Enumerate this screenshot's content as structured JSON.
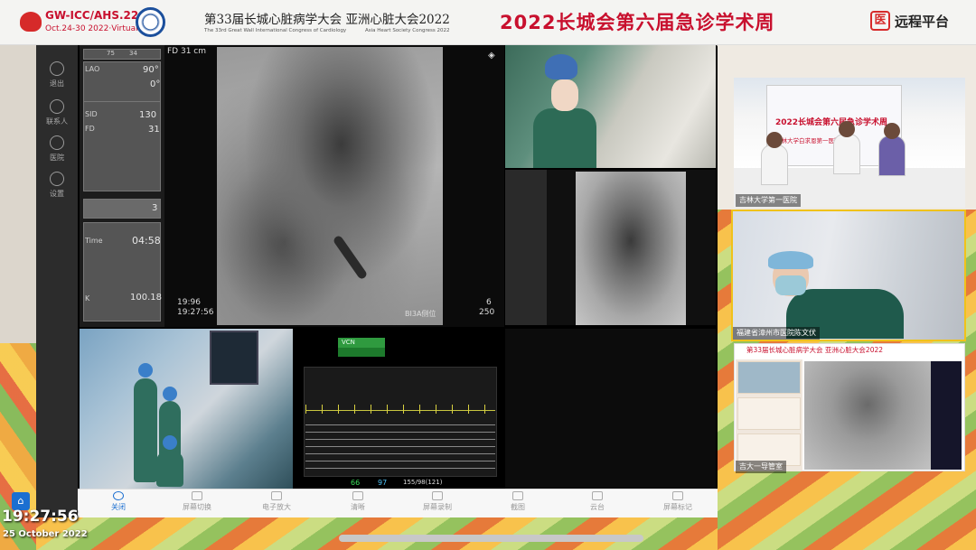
{
  "banner": {
    "gw_title": "GW-ICC/AHS.22",
    "gw_dates": "Oct.24-30 2022·Virtual",
    "conference_cn": "第33届长城心脏病学大会  亚洲心脏大会2022",
    "conference_en": "The 33rd Great Wall International Congress of Cardiology",
    "conference_en2": "Asia Heart Society Congress 2022",
    "week_title": "2022长城会第六届急诊学术周",
    "platform_icon_char": "医",
    "platform": "远程平台"
  },
  "rail": [
    {
      "label": "退出",
      "icon": "chat-icon"
    },
    {
      "label": "联系人",
      "icon": "contacts-icon"
    },
    {
      "label": "医院",
      "icon": "person-icon"
    },
    {
      "label": "设置",
      "icon": "gear-icon"
    }
  ],
  "console": {
    "top_vals": [
      "75",
      "34"
    ],
    "lao_label": "LAO",
    "lao_value": "90°",
    "cra_value": "0°",
    "sid_label": "SID",
    "sid_value": "130",
    "fd_label": "FD",
    "fd_value": "31",
    "frame_value": "3",
    "time_label": "Time",
    "time_value": "04:58",
    "k_label": "K",
    "k_value": "100.18"
  },
  "fluoro": {
    "fd_label": "FD 31 cm",
    "time1": "19:96",
    "time2": "19:27:56",
    "position": "BI3A侧位",
    "frame": "6",
    "number": "250"
  },
  "ecg": {
    "badge": "VCN",
    "hr": "66",
    "spo2": "97",
    "bp": "155/98(121)"
  },
  "toolbar": [
    {
      "label": "关闭",
      "icon": "power-icon",
      "active": true
    },
    {
      "label": "屏幕切换",
      "icon": "grid-icon"
    },
    {
      "label": "电子放大",
      "icon": "zoom-icon"
    },
    {
      "label": "清晰",
      "icon": "hd-icon"
    },
    {
      "label": "屏幕录制",
      "icon": "record-icon"
    },
    {
      "label": "截图",
      "icon": "screenshot-icon"
    },
    {
      "label": "云台",
      "icon": "ptz-icon"
    },
    {
      "label": "屏幕标记",
      "icon": "mark-icon"
    }
  ],
  "right_panels": {
    "p1_label": "吉林大学第一医院",
    "p1_screen_title": "2022长城会第六届急诊学术周",
    "p1_screen_sub": "吉林大学白求恩第一医院",
    "p2_label": "福建省漳州市医院陈文伏",
    "p3_header": "第33届长城心脏病学大会  亚洲心脏大会2022",
    "p3_label": "吉大一导管室"
  },
  "timestamp": {
    "time": "19:27:56",
    "date": "25 October 2022"
  },
  "colors": {
    "brand_red": "#c8102e",
    "accent_blue": "#1b6fd1",
    "highlight_yellow": "#f0c21a"
  }
}
